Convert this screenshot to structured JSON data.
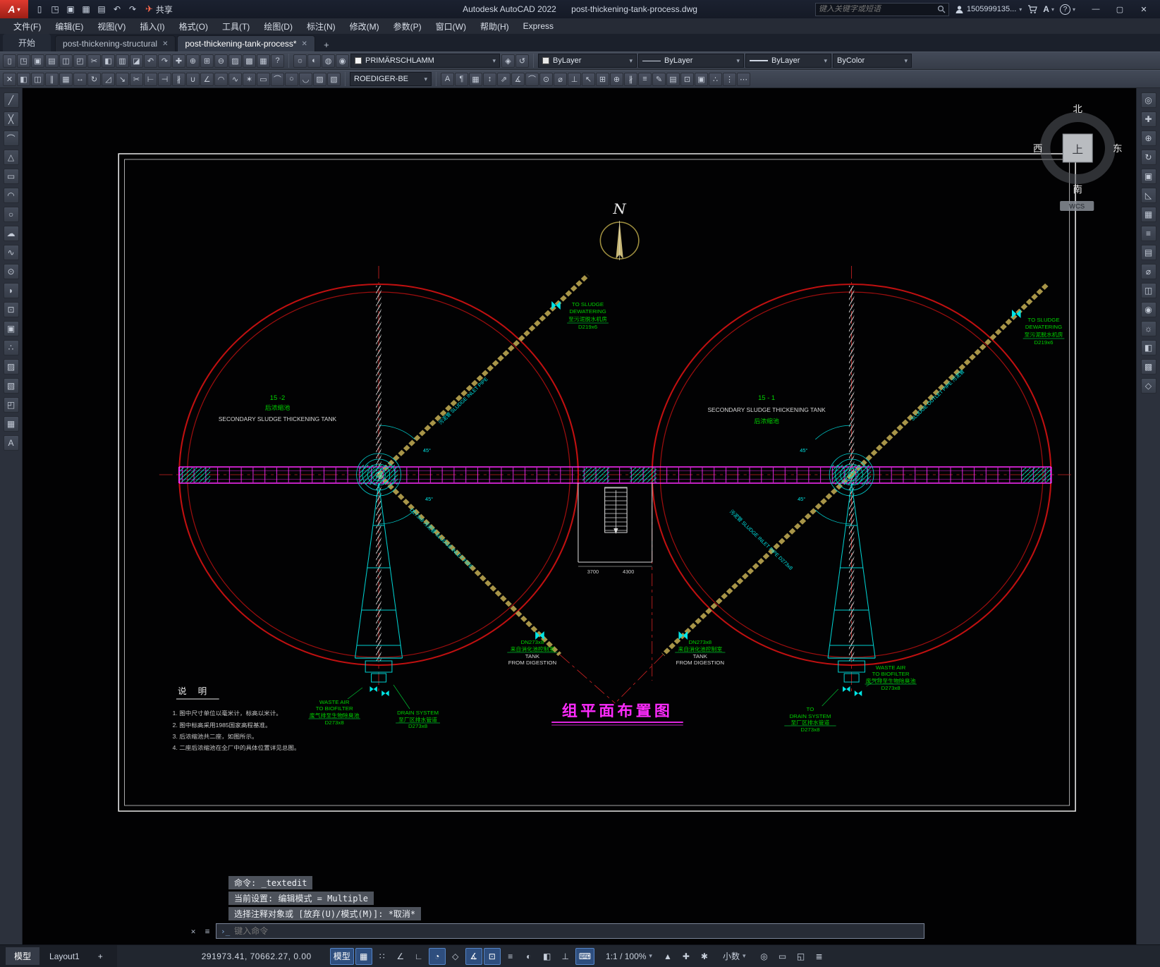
{
  "glyphs": {
    "caret": "▾",
    "close": "✕",
    "x": "✕",
    "plus": "+",
    "min": "—",
    "max": "▢",
    "help": "?",
    "menu_a": "A",
    "linetype_dash": "—"
  },
  "window": {
    "app_title": "Autodesk AutoCAD 2022",
    "doc_title": "post-thickening-tank-process.dwg"
  },
  "titlebar": {
    "logo": "A",
    "share": "共享",
    "search_placeholder": "键入关键字或短语",
    "account": "1505999135...",
    "qat": [
      {
        "name": "new-file-icon",
        "glyph": "▯"
      },
      {
        "name": "open-folder-icon",
        "glyph": "◳"
      },
      {
        "name": "save-icon",
        "glyph": "▣"
      },
      {
        "name": "save-as-icon",
        "glyph": "▦"
      },
      {
        "name": "plot-icon",
        "glyph": "▤"
      },
      {
        "name": "undo-icon",
        "glyph": "↶"
      },
      {
        "name": "redo-icon",
        "glyph": "↷"
      }
    ]
  },
  "menubar": {
    "items": [
      "文件(F)",
      "编辑(E)",
      "视图(V)",
      "插入(I)",
      "格式(O)",
      "工具(T)",
      "绘图(D)",
      "标注(N)",
      "修改(M)",
      "参数(P)",
      "窗口(W)",
      "帮助(H)",
      "Express"
    ]
  },
  "doc_tabs": {
    "start": "开始",
    "items": [
      {
        "label": "post-thickening-structural",
        "active": false
      },
      {
        "label": "post-thickening-tank-process*",
        "active": true
      }
    ]
  },
  "toolbars": {
    "row1": [
      {
        "name": "qnew-icon",
        "glyph": "▯"
      },
      {
        "name": "open-icon",
        "glyph": "◳"
      },
      {
        "name": "save-tool-icon",
        "glyph": "▣"
      },
      {
        "name": "plot-tool-icon",
        "glyph": "▤"
      },
      {
        "name": "plot-preview-icon",
        "glyph": "◫"
      },
      {
        "name": "publish-icon",
        "glyph": "◰"
      },
      {
        "name": "cut-icon",
        "glyph": "✂"
      },
      {
        "name": "copy-clip-icon",
        "glyph": "◧"
      },
      {
        "name": "paste-icon",
        "glyph": "▥"
      },
      {
        "name": "match-properties-icon",
        "glyph": "◪"
      },
      {
        "name": "undo-tool-icon",
        "glyph": "↶"
      },
      {
        "name": "redo-tool-icon",
        "glyph": "↷"
      },
      {
        "name": "pan-icon",
        "glyph": "✚"
      },
      {
        "name": "zoom-realtime-icon",
        "glyph": "⊕"
      },
      {
        "name": "zoom-window-icon",
        "glyph": "⊞"
      },
      {
        "name": "zoom-previous-icon",
        "glyph": "⊖"
      },
      {
        "name": "properties-icon",
        "glyph": "▨"
      },
      {
        "name": "designcenter-icon",
        "glyph": "▩"
      },
      {
        "name": "tool-palettes-icon",
        "glyph": "▦"
      },
      {
        "name": "help-icon",
        "glyph": "?"
      }
    ],
    "layer_vis": [
      {
        "name": "layer-on-icon",
        "glyph": "☼"
      },
      {
        "name": "layer-isolate-icon",
        "glyph": "◐"
      },
      {
        "name": "layer-freeze-icon",
        "glyph": "◍"
      },
      {
        "name": "layer-lock-icon",
        "glyph": "◉"
      }
    ],
    "layer_value": "PRIMÄRSCHLAMM",
    "layer_tools": [
      {
        "name": "make-object-layer-current-icon",
        "glyph": "◈"
      },
      {
        "name": "layer-previous-icon",
        "glyph": "↺"
      }
    ],
    "color_value": "ByLayer",
    "linetype_value": "ByLayer",
    "lineweight_value": "ByLayer",
    "plotstyle_value": "ByColor",
    "row2a": [
      {
        "name": "erase-icon",
        "glyph": "✕"
      },
      {
        "name": "copy-object-icon",
        "glyph": "◧"
      },
      {
        "name": "mirror-icon",
        "glyph": "◫"
      },
      {
        "name": "offset-icon",
        "glyph": "∥"
      },
      {
        "name": "array-icon",
        "glyph": "▦"
      },
      {
        "name": "move-icon",
        "glyph": "↔"
      },
      {
        "name": "rotate-icon",
        "glyph": "↻"
      },
      {
        "name": "scale-icon",
        "glyph": "◿"
      },
      {
        "name": "stretch-icon",
        "glyph": "↘"
      },
      {
        "name": "trim-icon",
        "glyph": "✂"
      },
      {
        "name": "extend-icon",
        "glyph": "⊢"
      },
      {
        "name": "break-at-point-icon",
        "glyph": "⊣"
      },
      {
        "name": "break-icon",
        "glyph": "∦"
      },
      {
        "name": "join-icon",
        "glyph": "∪"
      },
      {
        "name": "chamfer-icon",
        "glyph": "∠"
      },
      {
        "name": "fillet-icon",
        "glyph": "◠"
      },
      {
        "name": "blend-icon",
        "glyph": "∿"
      },
      {
        "name": "explode-icon",
        "glyph": "✶"
      },
      {
        "name": "rectangle-icon",
        "glyph": "▭"
      },
      {
        "name": "polyline-mod-icon",
        "glyph": "⌒"
      },
      {
        "name": "circle-mod-icon",
        "glyph": "○"
      },
      {
        "name": "arc-mod-icon",
        "glyph": "◡"
      },
      {
        "name": "hatch-mod-icon",
        "glyph": "▨"
      },
      {
        "name": "gradient-mod-icon",
        "glyph": "▧"
      }
    ],
    "text_style_value": "ROEDIGER-BE",
    "row2b": [
      {
        "name": "single-text-icon",
        "glyph": "A"
      },
      {
        "name": "mtext-icon",
        "glyph": "¶"
      },
      {
        "name": "table-icon",
        "glyph": "▦"
      },
      {
        "name": "dim-linear-icon",
        "glyph": "↕"
      },
      {
        "name": "dim-aligned-icon",
        "glyph": "⇗"
      },
      {
        "name": "dim-angular-icon",
        "glyph": "∡"
      },
      {
        "name": "dim-arc-icon",
        "glyph": "⌒"
      },
      {
        "name": "dim-radius-icon",
        "glyph": "⊙"
      },
      {
        "name": "dim-diameter-icon",
        "glyph": "⌀"
      },
      {
        "name": "dim-ordinate-icon",
        "glyph": "⊥"
      },
      {
        "name": "leader-icon",
        "glyph": "↖"
      },
      {
        "name": "tolerance-icon",
        "glyph": "⊞"
      },
      {
        "name": "center-mark-icon",
        "glyph": "⊕"
      },
      {
        "name": "dim-break-icon",
        "glyph": "∦"
      },
      {
        "name": "dim-space-icon",
        "glyph": "≡"
      },
      {
        "name": "dim-edit-icon",
        "glyph": "✎"
      },
      {
        "name": "dim-style-icon",
        "glyph": "▤"
      },
      {
        "name": "insert-block-icon",
        "glyph": "⊡"
      },
      {
        "name": "create-block-icon",
        "glyph": "▣"
      },
      {
        "name": "point-style-icon",
        "glyph": "∴"
      },
      {
        "name": "divide-icon",
        "glyph": "⋮"
      },
      {
        "name": "measure-icon",
        "glyph": "⋯"
      }
    ]
  },
  "left_rail": [
    {
      "name": "line-icon",
      "glyph": "╱"
    },
    {
      "name": "construction-line-icon",
      "glyph": "╳"
    },
    {
      "name": "polyline-icon",
      "glyph": "⌒"
    },
    {
      "name": "polygon-icon",
      "glyph": "△"
    },
    {
      "name": "rectangle-tool-icon",
      "glyph": "▭"
    },
    {
      "name": "arc-icon",
      "glyph": "◠"
    },
    {
      "name": "circle-icon",
      "glyph": "○"
    },
    {
      "name": "revcloud-icon",
      "glyph": "☁"
    },
    {
      "name": "spline-icon",
      "glyph": "∿"
    },
    {
      "name": "ellipse-icon",
      "glyph": "⊙"
    },
    {
      "name": "ellipse-arc-icon",
      "glyph": "◗"
    },
    {
      "name": "insert-icon",
      "glyph": "⊡"
    },
    {
      "name": "make-block-icon",
      "glyph": "▣"
    },
    {
      "name": "point-icon",
      "glyph": "∴"
    },
    {
      "name": "hatch-icon",
      "glyph": "▨"
    },
    {
      "name": "gradient-icon",
      "glyph": "▧"
    },
    {
      "name": "region-icon",
      "glyph": "◰"
    },
    {
      "name": "table-tool-icon",
      "glyph": "▦"
    },
    {
      "name": "mtext-tool-icon",
      "glyph": "A"
    }
  ],
  "right_rail": [
    {
      "name": "nav-wheel-icon",
      "glyph": "◎"
    },
    {
      "name": "nav-pan-icon",
      "glyph": "✚"
    },
    {
      "name": "nav-zoom-icon",
      "glyph": "⊕"
    },
    {
      "name": "nav-orbit-icon",
      "glyph": "↻"
    },
    {
      "name": "show-motion-icon",
      "glyph": "▣"
    },
    {
      "name": "ucs-icon",
      "glyph": "◺"
    },
    {
      "name": "grid-display-icon",
      "glyph": "▦"
    },
    {
      "name": "layers-panel-icon",
      "glyph": "≡"
    },
    {
      "name": "properties-panel-icon",
      "glyph": "▤"
    },
    {
      "name": "measure-tool-icon",
      "glyph": "⌀"
    },
    {
      "name": "section-icon",
      "glyph": "◫"
    },
    {
      "name": "camera-icon",
      "glyph": "◉"
    },
    {
      "name": "light-icon",
      "glyph": "☼"
    },
    {
      "name": "materials-icon",
      "glyph": "◧"
    },
    {
      "name": "render-icon",
      "glyph": "▩"
    },
    {
      "name": "named-views-icon",
      "glyph": "◇"
    }
  ],
  "drawing": {
    "north": "N",
    "viewcube": {
      "north": "北",
      "south": "南",
      "west": "西",
      "east": "东",
      "top": "上",
      "wcs": "WCS"
    },
    "left_tank": {
      "tag": "15 -2",
      "cn": "后浓缩池",
      "en": "SECONDARY SLUDGE THICKENING TANK"
    },
    "right_tank": {
      "tag": "15 - 1",
      "en": "SECONDARY SLUDGE THICKENING TANK",
      "cn": "后浓缩池"
    },
    "dewater_left": [
      "TO SLUDGE",
      "DEWATERING",
      "至污泥脱水机房",
      "D219x6"
    ],
    "dewater_right": [
      "TO SLUDGE",
      "DEWATERING",
      "至污泥脱水机房",
      "D219x6"
    ],
    "digest_left": [
      "DN273x8",
      "来自消化池控制室",
      "TANK",
      "FROM DIGESTION"
    ],
    "digest_right": [
      "DN273x8",
      "来自消化池控制室",
      "TANK",
      "FROM DIGESTION"
    ],
    "waste_left": [
      "WASTE AIR",
      "TO BIOFILTER",
      "废气排至生物除臭池",
      "D273x8"
    ],
    "drain_left": [
      "DRAIN SYSTEM",
      "至厂区排水管道",
      "D273x8"
    ],
    "waste_right": [
      "WASTE AIR",
      "TO BIOFILTER",
      "废气排至生物除臭池",
      "D273x8"
    ],
    "drain_right": [
      "TO",
      "DRAIN SYSTEM",
      "至厂区排水管道",
      "D273x8"
    ],
    "pipe_ul": "污泥管 SLUDGE INLET PIPE",
    "pipe_dl": "D273x8 污泥管 SLUDGE INLET PIPE",
    "pipe_ur": "SLUDGE OUTLET PIPE 污泥管",
    "pipe_dr": "污泥管 SLUDGE INLET PIPE D273x8",
    "angle": "45°",
    "dim_a": "3700",
    "dim_b": "4300",
    "main_title": "组平面布置图",
    "notes_title": "说 明",
    "notes": [
      "1. 图中尺寸单位以毫米计，标高以米计。",
      "2. 图中标高采用1985国家高程基准。",
      "3. 后浓缩池共二座，如图所示。",
      "4. 二座后浓缩池在全厂中的具体位置详见总图。"
    ]
  },
  "command": {
    "history": [
      "命令: _textedit",
      "当前设置: 编辑模式 = Multiple",
      "选择注释对象或 [放弃(U)/模式(M)]: *取消*"
    ],
    "placeholder": "键入命令",
    "prompt": "›_",
    "tools": [
      {
        "name": "close-commandline-icon",
        "glyph": "✕"
      },
      {
        "name": "customize-commandline-icon",
        "glyph": "≡"
      }
    ]
  },
  "statusbar": {
    "model_tab": "模型",
    "layout_tab": "Layout1",
    "plus": "+",
    "coords": "291973.41, 70662.27, 0.00",
    "toggles": [
      {
        "name": "model-space-toggle",
        "glyph": "模型",
        "active": true
      },
      {
        "name": "grid-toggle",
        "glyph": "▦",
        "active": true
      },
      {
        "name": "snap-toggle",
        "glyph": "∷",
        "active": false
      },
      {
        "name": "infer-constraints-toggle",
        "glyph": "∠",
        "active": false
      },
      {
        "name": "ortho-toggle",
        "glyph": "∟",
        "active": false
      },
      {
        "name": "polar-tracking-toggle",
        "glyph": "◔",
        "active": true
      },
      {
        "name": "isodraft-toggle",
        "glyph": "◇",
        "active": false
      },
      {
        "name": "osnap-tracking-toggle",
        "glyph": "∡",
        "active": true
      },
      {
        "name": "osnap-toggle",
        "glyph": "⊡",
        "active": true
      },
      {
        "name": "lineweight-toggle",
        "glyph": "≡",
        "active": false
      },
      {
        "name": "transparency-toggle",
        "glyph": "◐",
        "active": false
      },
      {
        "name": "selection-cycling-toggle",
        "glyph": "◧",
        "active": false
      },
      {
        "name": "dynamic-ucs-toggle",
        "glyph": "⊥",
        "active": false
      },
      {
        "name": "dynamic-input-toggle",
        "glyph": "⌨",
        "active": true
      }
    ],
    "scale": "1:1 / 100%",
    "mid_icons": [
      {
        "name": "annotation-visibility-icon",
        "glyph": "▲"
      },
      {
        "name": "annotation-autoscale-icon",
        "glyph": "✚"
      },
      {
        "name": "workspace-switch-icon",
        "glyph": "✱"
      }
    ],
    "units": "小数",
    "right_icons": [
      {
        "name": "graphics-performance-icon",
        "glyph": "◎"
      },
      {
        "name": "isolate-objects-icon",
        "glyph": "▭"
      },
      {
        "name": "clean-screen-icon",
        "glyph": "◱"
      },
      {
        "name": "customize-status-icon",
        "glyph": "≣"
      }
    ]
  }
}
